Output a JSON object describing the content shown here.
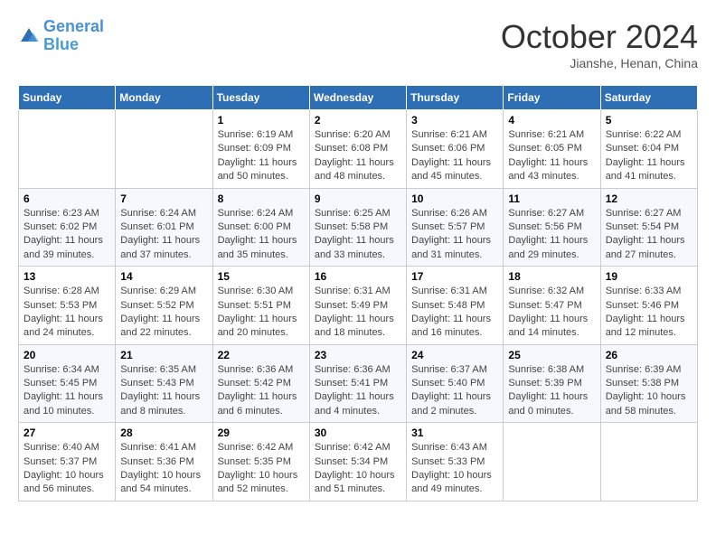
{
  "header": {
    "logo": {
      "line1": "General",
      "line2": "Blue"
    },
    "title": "October 2024",
    "subtitle": "Jianshe, Henan, China"
  },
  "weekdays": [
    "Sunday",
    "Monday",
    "Tuesday",
    "Wednesday",
    "Thursday",
    "Friday",
    "Saturday"
  ],
  "weeks": [
    [
      {
        "day": null
      },
      {
        "day": null
      },
      {
        "day": "1",
        "sunrise": "6:19 AM",
        "sunset": "6:09 PM",
        "daylight": "11 hours and 50 minutes."
      },
      {
        "day": "2",
        "sunrise": "6:20 AM",
        "sunset": "6:08 PM",
        "daylight": "11 hours and 48 minutes."
      },
      {
        "day": "3",
        "sunrise": "6:21 AM",
        "sunset": "6:06 PM",
        "daylight": "11 hours and 45 minutes."
      },
      {
        "day": "4",
        "sunrise": "6:21 AM",
        "sunset": "6:05 PM",
        "daylight": "11 hours and 43 minutes."
      },
      {
        "day": "5",
        "sunrise": "6:22 AM",
        "sunset": "6:04 PM",
        "daylight": "11 hours and 41 minutes."
      }
    ],
    [
      {
        "day": "6",
        "sunrise": "6:23 AM",
        "sunset": "6:02 PM",
        "daylight": "11 hours and 39 minutes."
      },
      {
        "day": "7",
        "sunrise": "6:24 AM",
        "sunset": "6:01 PM",
        "daylight": "11 hours and 37 minutes."
      },
      {
        "day": "8",
        "sunrise": "6:24 AM",
        "sunset": "6:00 PM",
        "daylight": "11 hours and 35 minutes."
      },
      {
        "day": "9",
        "sunrise": "6:25 AM",
        "sunset": "5:58 PM",
        "daylight": "11 hours and 33 minutes."
      },
      {
        "day": "10",
        "sunrise": "6:26 AM",
        "sunset": "5:57 PM",
        "daylight": "11 hours and 31 minutes."
      },
      {
        "day": "11",
        "sunrise": "6:27 AM",
        "sunset": "5:56 PM",
        "daylight": "11 hours and 29 minutes."
      },
      {
        "day": "12",
        "sunrise": "6:27 AM",
        "sunset": "5:54 PM",
        "daylight": "11 hours and 27 minutes."
      }
    ],
    [
      {
        "day": "13",
        "sunrise": "6:28 AM",
        "sunset": "5:53 PM",
        "daylight": "11 hours and 24 minutes."
      },
      {
        "day": "14",
        "sunrise": "6:29 AM",
        "sunset": "5:52 PM",
        "daylight": "11 hours and 22 minutes."
      },
      {
        "day": "15",
        "sunrise": "6:30 AM",
        "sunset": "5:51 PM",
        "daylight": "11 hours and 20 minutes."
      },
      {
        "day": "16",
        "sunrise": "6:31 AM",
        "sunset": "5:49 PM",
        "daylight": "11 hours and 18 minutes."
      },
      {
        "day": "17",
        "sunrise": "6:31 AM",
        "sunset": "5:48 PM",
        "daylight": "11 hours and 16 minutes."
      },
      {
        "day": "18",
        "sunrise": "6:32 AM",
        "sunset": "5:47 PM",
        "daylight": "11 hours and 14 minutes."
      },
      {
        "day": "19",
        "sunrise": "6:33 AM",
        "sunset": "5:46 PM",
        "daylight": "11 hours and 12 minutes."
      }
    ],
    [
      {
        "day": "20",
        "sunrise": "6:34 AM",
        "sunset": "5:45 PM",
        "daylight": "11 hours and 10 minutes."
      },
      {
        "day": "21",
        "sunrise": "6:35 AM",
        "sunset": "5:43 PM",
        "daylight": "11 hours and 8 minutes."
      },
      {
        "day": "22",
        "sunrise": "6:36 AM",
        "sunset": "5:42 PM",
        "daylight": "11 hours and 6 minutes."
      },
      {
        "day": "23",
        "sunrise": "6:36 AM",
        "sunset": "5:41 PM",
        "daylight": "11 hours and 4 minutes."
      },
      {
        "day": "24",
        "sunrise": "6:37 AM",
        "sunset": "5:40 PM",
        "daylight": "11 hours and 2 minutes."
      },
      {
        "day": "25",
        "sunrise": "6:38 AM",
        "sunset": "5:39 PM",
        "daylight": "11 hours and 0 minutes."
      },
      {
        "day": "26",
        "sunrise": "6:39 AM",
        "sunset": "5:38 PM",
        "daylight": "10 hours and 58 minutes."
      }
    ],
    [
      {
        "day": "27",
        "sunrise": "6:40 AM",
        "sunset": "5:37 PM",
        "daylight": "10 hours and 56 minutes."
      },
      {
        "day": "28",
        "sunrise": "6:41 AM",
        "sunset": "5:36 PM",
        "daylight": "10 hours and 54 minutes."
      },
      {
        "day": "29",
        "sunrise": "6:42 AM",
        "sunset": "5:35 PM",
        "daylight": "10 hours and 52 minutes."
      },
      {
        "day": "30",
        "sunrise": "6:42 AM",
        "sunset": "5:34 PM",
        "daylight": "10 hours and 51 minutes."
      },
      {
        "day": "31",
        "sunrise": "6:43 AM",
        "sunset": "5:33 PM",
        "daylight": "10 hours and 49 minutes."
      },
      {
        "day": null
      },
      {
        "day": null
      }
    ]
  ],
  "labels": {
    "sunrise_prefix": "Sunrise: ",
    "sunset_prefix": "Sunset: ",
    "daylight_prefix": "Daylight: "
  }
}
